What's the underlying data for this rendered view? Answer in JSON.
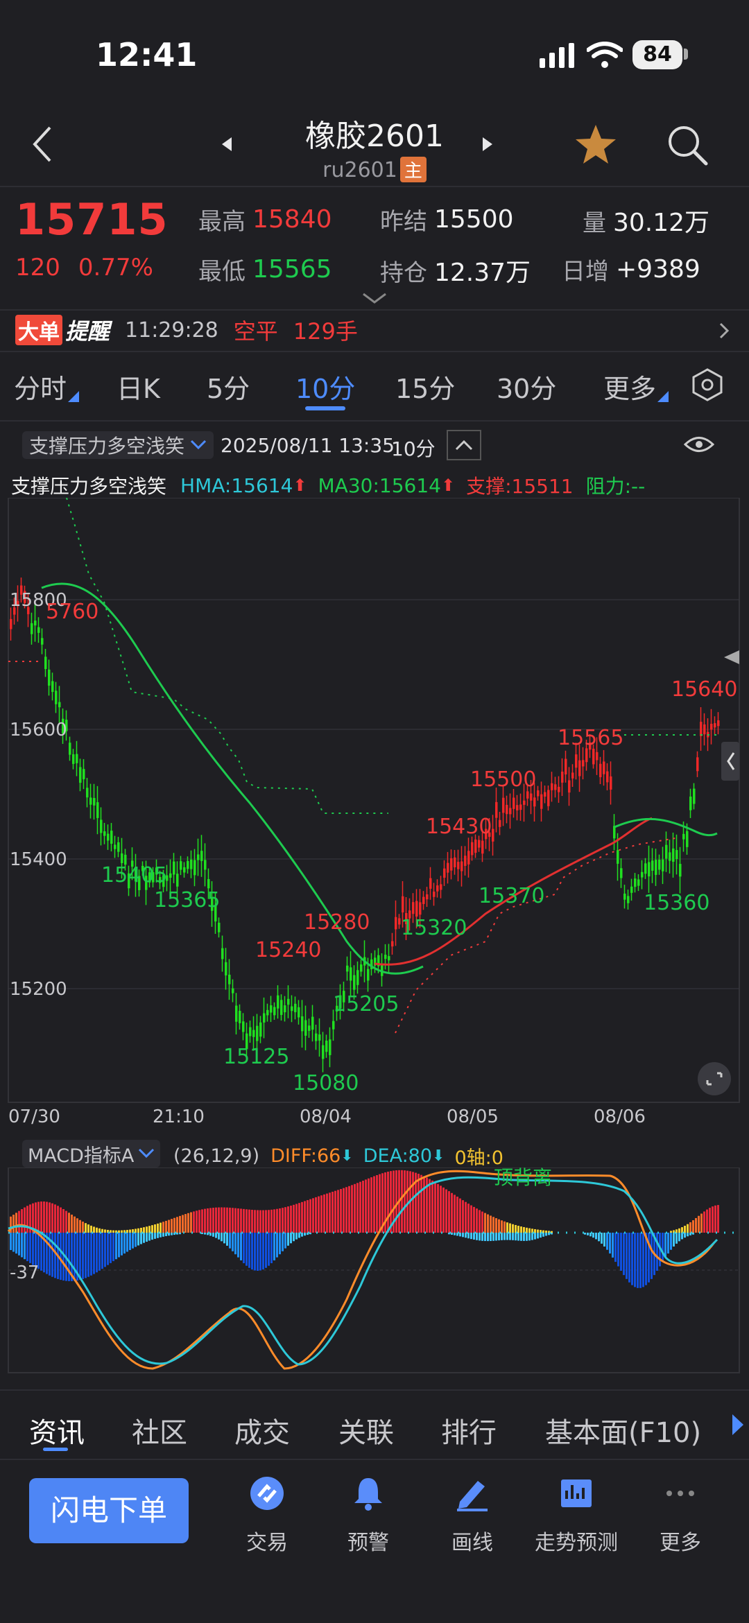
{
  "status": {
    "time": "12:41",
    "battery": "84"
  },
  "header": {
    "title": "橡胶2601",
    "code": "ru2601",
    "main_badge": "主"
  },
  "quote": {
    "price": "15715",
    "change": "120",
    "change_pct": "0.77%",
    "high_label": "最高",
    "high": "15840",
    "low_label": "最低",
    "low": "15565",
    "prev_label": "昨结",
    "prev": "15500",
    "oi_label": "持仓",
    "oi": "12.37万",
    "vol_label": "量",
    "vol": "30.12万",
    "daily_inc_label": "日增",
    "daily_inc": "+9389"
  },
  "alert": {
    "badge1": "大单",
    "badge2": "提醒",
    "time": "11:29:28",
    "action": "空平",
    "qty": "129手"
  },
  "period_tabs": [
    "分时",
    "日K",
    "5分",
    "10分",
    "15分",
    "30分",
    "更多"
  ],
  "active_tab": "10分",
  "indicator_bar": {
    "select": "支撑压力多空浅笑",
    "datetime": "2025/08/11 13:35",
    "period": "10分"
  },
  "legend": {
    "name": "支撑压力多空浅笑",
    "hma": "HMA:15614",
    "ma30": "MA30:15614",
    "support": "支撑:15511",
    "resist": "阻力:--"
  },
  "colors": {
    "up": "#f23b3b",
    "down": "#1ecb4f",
    "accent": "#4e8cff",
    "bg": "#1f1f23"
  },
  "chart_data": {
    "type": "candlestick",
    "y_ticks": [
      "15800",
      "15600",
      "15400",
      "15200"
    ],
    "x_ticks": [
      "07/30",
      "21:10",
      "08/04",
      "08/05",
      "08/06"
    ],
    "ylim": [
      15050,
      15900
    ],
    "annotations": [
      {
        "text": "5760",
        "color": "red"
      },
      {
        "text": "15405",
        "color": "green"
      },
      {
        "text": "15365",
        "color": "green"
      },
      {
        "text": "15240",
        "color": "red"
      },
      {
        "text": "15280",
        "color": "red"
      },
      {
        "text": "15125",
        "color": "green"
      },
      {
        "text": "15080",
        "color": "green"
      },
      {
        "text": "15205",
        "color": "green"
      },
      {
        "text": "15320",
        "color": "green"
      },
      {
        "text": "15430",
        "color": "red"
      },
      {
        "text": "15500",
        "color": "red"
      },
      {
        "text": "15370",
        "color": "green"
      },
      {
        "text": "15565",
        "color": "red"
      },
      {
        "text": "15360",
        "color": "green"
      },
      {
        "text": "15640",
        "color": "red"
      }
    ]
  },
  "macd": {
    "select": "MACD指标A",
    "params": "(26,12,9)",
    "diff": "DIFF:66",
    "dea": "DEA:80",
    "zero": "0轴:0",
    "tick": "-37",
    "note": "顶背离"
  },
  "info_tabs": [
    "资讯",
    "社区",
    "成交",
    "关联",
    "排行",
    "基本面(F10)"
  ],
  "bottom": {
    "order_button": "闪电下单",
    "nav": [
      "交易",
      "预警",
      "画线",
      "走势预测",
      "更多"
    ]
  }
}
